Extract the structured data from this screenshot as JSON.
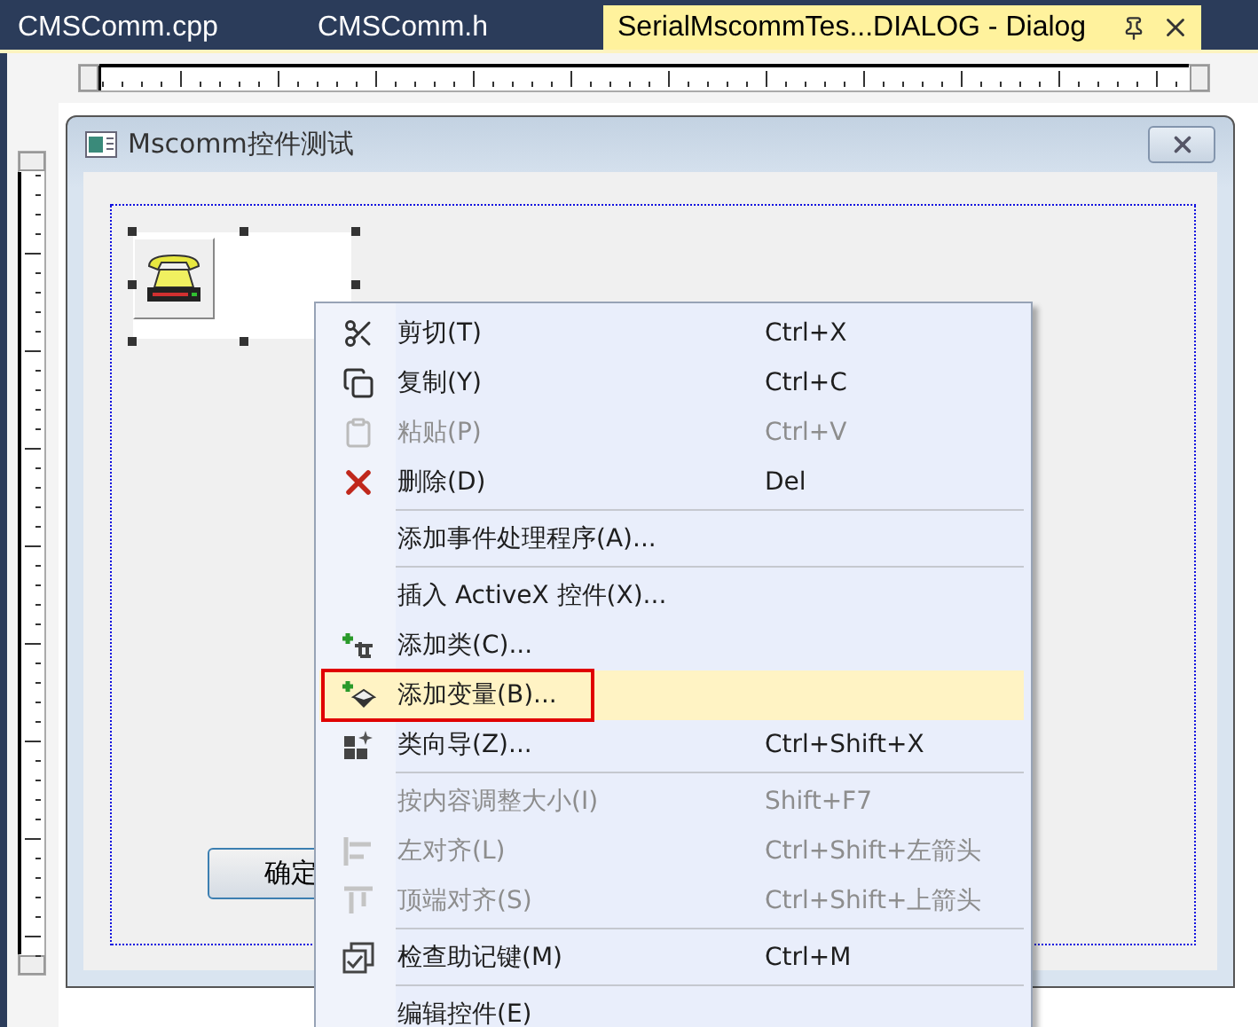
{
  "tabs": [
    {
      "label": "CMSComm.cpp",
      "selected": false
    },
    {
      "label": "CMSComm.h",
      "selected": false
    },
    {
      "label": "SerialMscommTes...DIALOG - Dialog",
      "selected": true
    }
  ],
  "dialog": {
    "title": "Mscomm控件测试",
    "ok_button": "确定"
  },
  "context_menu": {
    "groups": [
      {
        "items": [
          {
            "label": "剪切(T)",
            "shortcut": "Ctrl+X",
            "disabled": false,
            "selected": false,
            "annotated": false
          },
          {
            "label": "复制(Y)",
            "shortcut": "Ctrl+C",
            "disabled": false,
            "selected": false,
            "annotated": false
          },
          {
            "label": "粘贴(P)",
            "shortcut": "Ctrl+V",
            "disabled": true,
            "selected": false,
            "annotated": false
          },
          {
            "label": "删除(D)",
            "shortcut": "Del",
            "disabled": false,
            "selected": false,
            "annotated": false
          }
        ]
      },
      {
        "items": [
          {
            "label": "添加事件处理程序(A)...",
            "disabled": false,
            "selected": false,
            "annotated": false
          }
        ]
      },
      {
        "items": [
          {
            "label": "插入 ActiveX 控件(X)...",
            "disabled": false,
            "selected": false,
            "annotated": false
          },
          {
            "label": "添加类(C)...",
            "disabled": false,
            "selected": false,
            "annotated": false
          },
          {
            "label": "添加变量(B)...",
            "disabled": false,
            "selected": true,
            "annotated": true
          },
          {
            "label": "类向导(Z)...",
            "shortcut": "Ctrl+Shift+X",
            "disabled": false,
            "selected": false,
            "annotated": false
          }
        ]
      },
      {
        "items": [
          {
            "label": "按内容调整大小(I)",
            "shortcut": "Shift+F7",
            "disabled": true,
            "selected": false,
            "annotated": false
          },
          {
            "label": "左对齐(L)",
            "shortcut": "Ctrl+Shift+左箭头",
            "disabled": true,
            "selected": false,
            "annotated": false
          },
          {
            "label": "顶端对齐(S)",
            "shortcut": "Ctrl+Shift+上箭头",
            "disabled": true,
            "selected": false,
            "annotated": false
          }
        ]
      },
      {
        "items": [
          {
            "label": "检查助记键(M)",
            "shortcut": "Ctrl+M",
            "disabled": false,
            "selected": false,
            "annotated": false
          }
        ]
      },
      {
        "items": [
          {
            "label": "编辑控件(E)",
            "disabled": false,
            "selected": false,
            "annotated": false
          }
        ]
      }
    ]
  }
}
